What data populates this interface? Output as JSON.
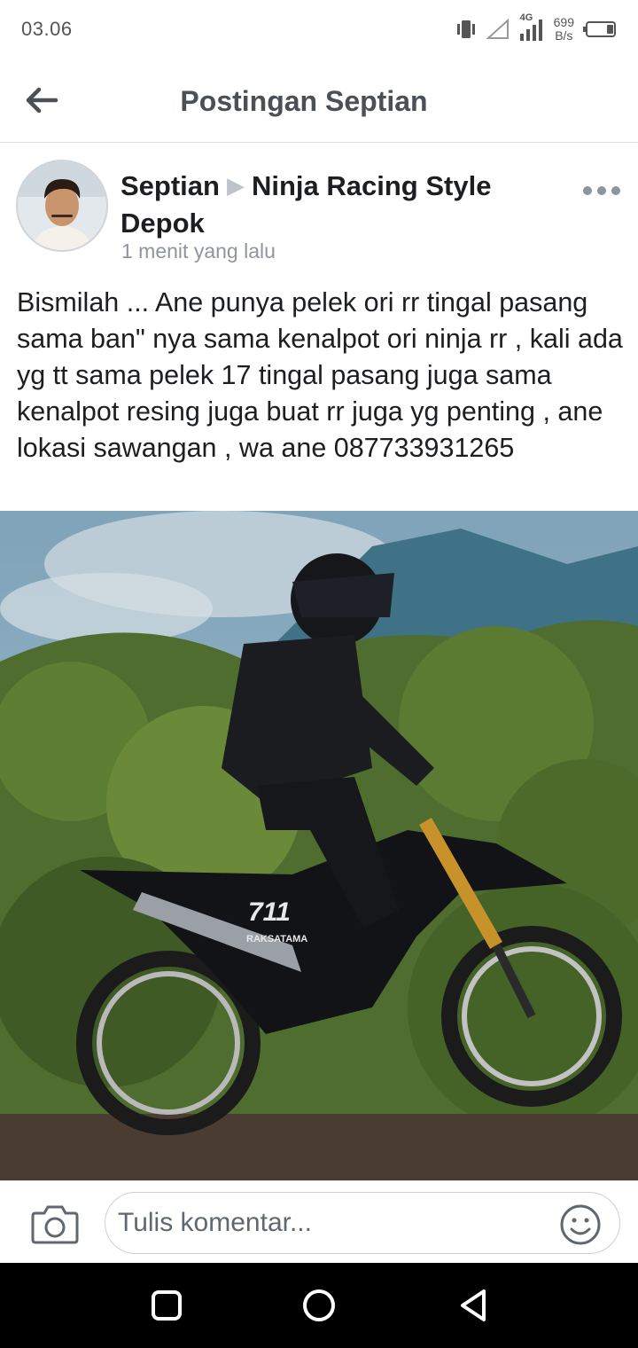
{
  "status_bar": {
    "time": "03.06",
    "network": "4G",
    "speed_value": "699",
    "speed_unit": "B/s"
  },
  "header": {
    "title": "Postingan Septian",
    "back_icon": "arrow-left-icon"
  },
  "post": {
    "author": "Septian",
    "group": "Ninja Racing Style Depok",
    "time": "1 menit yang lalu",
    "text": "Bismilah ... Ane punya pelek ori rr tingal pasang sama ban\" nya sama kenalpot ori ninja rr , kali ada yg tt sama pelek 17 tingal pasang juga sama kenalpot resing juga buat rr juga yg penting , ane lokasi sawangan , wa ane 087733931265",
    "photo_bike_text": "711",
    "photo_bike_brand": "RAKSATAMA"
  },
  "comment_bar": {
    "placeholder": "Tulis komentar...",
    "camera_icon": "camera-icon",
    "emoji_icon": "smiley-icon"
  },
  "nav_bar": {
    "icons": [
      "recent-apps-icon",
      "home-icon",
      "back-triangle-icon"
    ]
  },
  "colors": {
    "text_primary": "#1c1e21",
    "text_secondary": "#90949c",
    "header_title": "#4b4f56",
    "divider": "#dadde1"
  }
}
